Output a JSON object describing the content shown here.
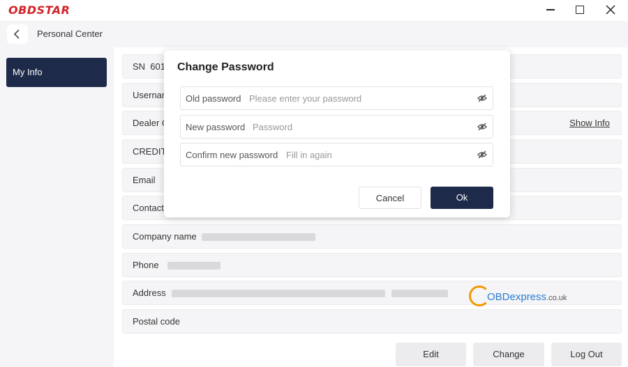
{
  "app": {
    "logo": "OBDSTAR"
  },
  "nav": {
    "title": "Personal Center"
  },
  "sidebar": {
    "items": [
      {
        "label": "My Info",
        "active": true
      }
    ]
  },
  "info": {
    "rows": [
      {
        "label": "SN",
        "value": "601"
      },
      {
        "label": "Usernar"
      },
      {
        "label": "Dealer C",
        "action": "Show Info"
      },
      {
        "label": "CREDIT"
      },
      {
        "label": "Email"
      },
      {
        "label": "Contact"
      },
      {
        "label": "Company name"
      },
      {
        "label": "Phone"
      },
      {
        "label": "Address"
      },
      {
        "label": "Postal code"
      }
    ]
  },
  "actions": {
    "edit": "Edit",
    "change_password": "Change Password",
    "logout": "Log Out"
  },
  "watermark": {
    "brand": "OBDexpress",
    "suffix": ".co.uk"
  },
  "modal": {
    "title": "Change Password",
    "fields": [
      {
        "label": "Old password",
        "placeholder": "Please enter your password"
      },
      {
        "label": "New password",
        "placeholder": "Password"
      },
      {
        "label": "Confirm new password",
        "placeholder": "Fill in again"
      }
    ],
    "cancel": "Cancel",
    "ok": "Ok"
  },
  "colors": {
    "accent": "#1e2a4a",
    "logo_red": "#d2232a",
    "panel_bg": "#f5f5f7"
  }
}
